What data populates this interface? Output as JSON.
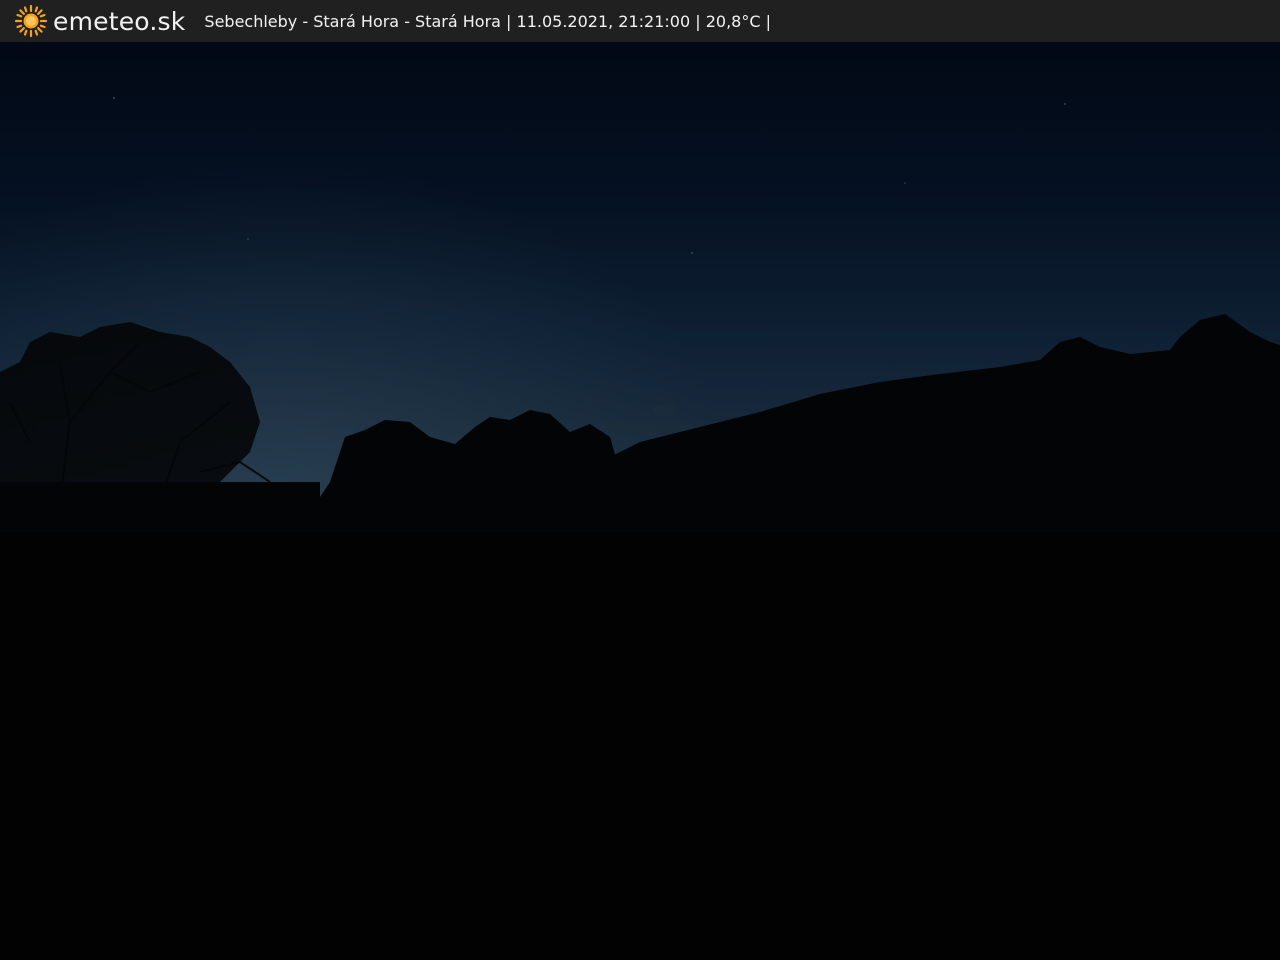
{
  "header": {
    "logo_icon": "sun-icon",
    "brand": "emeteo.sk",
    "caption": "Sebechleby - Stará Hora - Stará Hora | 11.05.2021, 21:21:00 | 20,8°C |"
  },
  "colors": {
    "header_bg": "#202020",
    "sun": "#f6a21a",
    "sky_top": "#020815",
    "sky_horizon": "#1e3345"
  }
}
